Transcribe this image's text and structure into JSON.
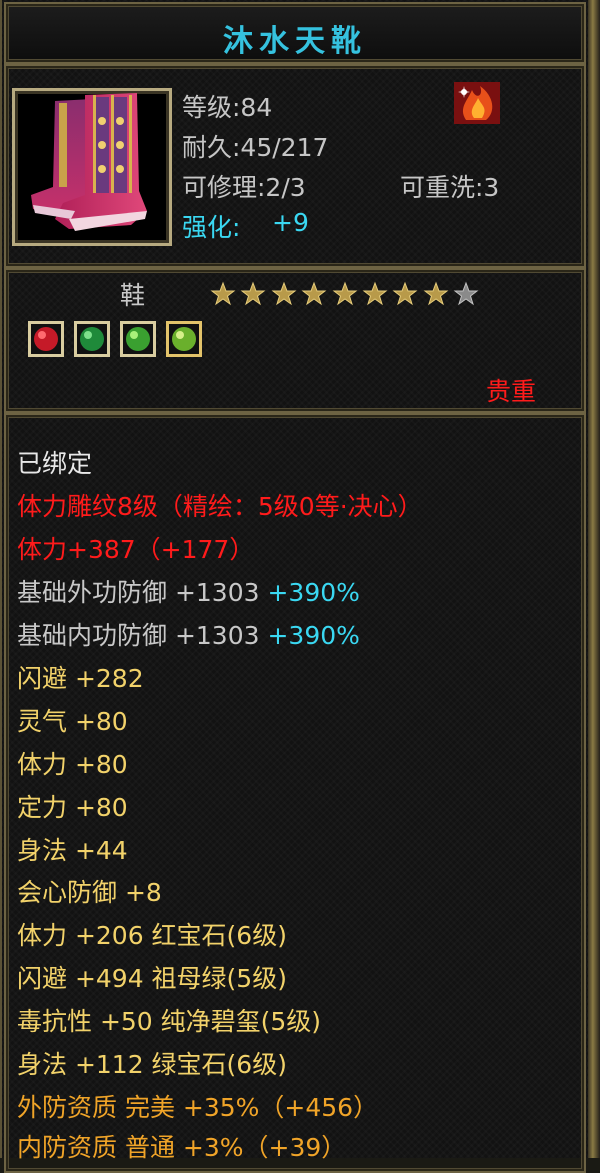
{
  "item": {
    "name": "沐水天靴",
    "level": "等级:84",
    "durability": "耐久:45/217",
    "repairable": "可修理:2/3",
    "rewashable": "可重洗:3",
    "enhance_label": "强化:",
    "enhance_value": "+9",
    "slot": "鞋",
    "rarity": "贵重",
    "stars_filled": 8,
    "stars_total": 9
  },
  "gems": [
    {
      "name": "ruby-gem",
      "color": "#e0202a"
    },
    {
      "name": "green-gem",
      "color": "#2fb04a"
    },
    {
      "name": "green-gem",
      "color": "#4ec23a"
    },
    {
      "name": "jade-gem",
      "color": "#9ad03c"
    }
  ],
  "attributes": {
    "bound": "已绑定",
    "engrave": "体力雕纹8级（精绘：5级0等·决心）",
    "strength": "体力+387（+177）",
    "ext_def": {
      "label": "基础外功防御 +1303 ",
      "bonus": "+390%"
    },
    "int_def": {
      "label": "基础内功防御 +1303 ",
      "bonus": "+390%"
    },
    "dodge": "闪避 +282",
    "spirit": "灵气 +80",
    "stamina": "体力 +80",
    "focus": "定力 +80",
    "agility": "身法 +44",
    "crit_def": "会心防御 +8",
    "gem_stamina": "体力 +206 红宝石(6级)",
    "gem_dodge": "闪避 +494 祖母绿(5级)",
    "gem_poison": "毒抗性 +50 纯净碧玺(5级)",
    "gem_agility": "身法 +112 绿宝石(6级)",
    "ext_quality": "外防资质  完美 +35%（+456）",
    "int_quality": "内防资质  普通 +3%（+39）"
  }
}
